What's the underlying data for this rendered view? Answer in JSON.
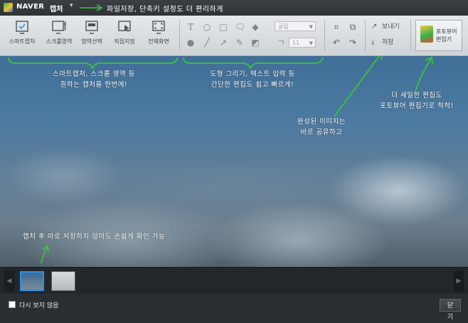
{
  "titlebar": {
    "brand": "NAVER",
    "app_name": "캡처",
    "annotation": "파일저장, 단축키 설정도 더 편리하게"
  },
  "toolbar": {
    "capture_tools": [
      {
        "label": "스마트캡처",
        "icon": "smart-capture-icon"
      },
      {
        "label": "스크롤영역",
        "icon": "scroll-capture-icon"
      },
      {
        "label": "영역선택",
        "icon": "region-select-icon"
      },
      {
        "label": "직접지정",
        "icon": "manual-select-icon"
      },
      {
        "label": "전체화면",
        "icon": "fullscreen-icon"
      }
    ],
    "font_dropdown": "굴림",
    "font_size_dropdown": "11",
    "send_label": "보내기",
    "save_label": "저장",
    "photo_editor_line1": "포토뷰어",
    "photo_editor_line2": "편집기"
  },
  "annotations": {
    "capture_line1": "스마트캡처, 스크롤 영역 등",
    "capture_line2": "원하는 캡처를 한번에!",
    "edit_line1": "도형 그리기, 텍스트 입력 등",
    "edit_line2": "간단한 편집도 쉽고 빠르게!",
    "share_line1": "완성된 이미지는",
    "share_line2": "바로 공유하고",
    "photo_line1": "더 세밀한 편집도",
    "photo_line2": "포토뷰어 편집기로 척척!",
    "thumb_line": "캡처 후 따로 저장하지 않아도 손쉽게 확인 가능"
  },
  "footer": {
    "dont_show_again": "다시 보지 않음",
    "close_label": "닫기"
  },
  "colors": {
    "toolbar_bg": "#dcdfe1",
    "chrome_dark": "#2b2f33",
    "selection_blue": "#2f8fe0",
    "annotation_green": "#39c43d"
  }
}
